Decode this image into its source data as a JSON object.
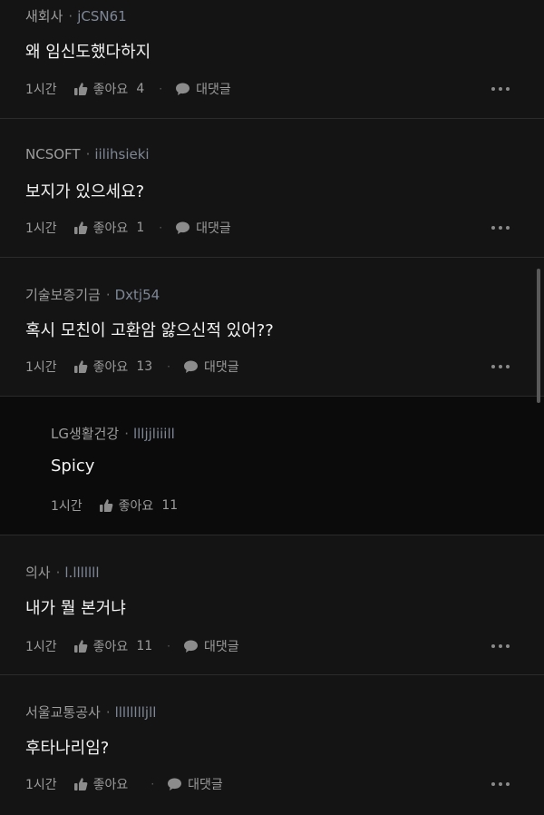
{
  "comments": [
    {
      "company": "새회사",
      "nick": "jCSN61",
      "text": "왜 임신도했다하지",
      "time": "1시간",
      "like_label": "좋아요",
      "likes": "4",
      "reply_label": "대댓글"
    },
    {
      "company": "NCSOFT",
      "nick": "iilihsieki",
      "text": "보지가 있으세요?",
      "time": "1시간",
      "like_label": "좋아요",
      "likes": "1",
      "reply_label": "대댓글"
    },
    {
      "company": "기술보증기금",
      "nick": "Dxtj54",
      "text": "혹시 모친이 고환암 앓으신적 있어??",
      "time": "1시간",
      "like_label": "좋아요",
      "likes": "13",
      "reply_label": "대댓글"
    },
    {
      "company": "LG생활건강",
      "nick": "llljjliiill",
      "text": "Spicy",
      "time": "1시간",
      "like_label": "좋아요",
      "likes": "11",
      "reply_label": ""
    },
    {
      "company": "의사",
      "nick": "l.lllllll",
      "text": "내가 뭘 본거냐",
      "time": "1시간",
      "like_label": "좋아요",
      "likes": "11",
      "reply_label": "대댓글"
    },
    {
      "company": "서울교통공사",
      "nick": "lllllllljll",
      "text": "후타나리임?",
      "time": "1시간",
      "like_label": "좋아요",
      "likes": "",
      "reply_label": "대댓글"
    }
  ],
  "meta_separator": "·",
  "icons": {
    "like": "thumbs-up-icon",
    "reply": "speech-bubble-icon",
    "more": "more-dots-icon"
  },
  "colors": {
    "background": "#141414",
    "reply_background": "#0b0b0b",
    "text": "#f2f2f2",
    "muted": "#9c9c9c",
    "nickname": "#7e8796"
  }
}
